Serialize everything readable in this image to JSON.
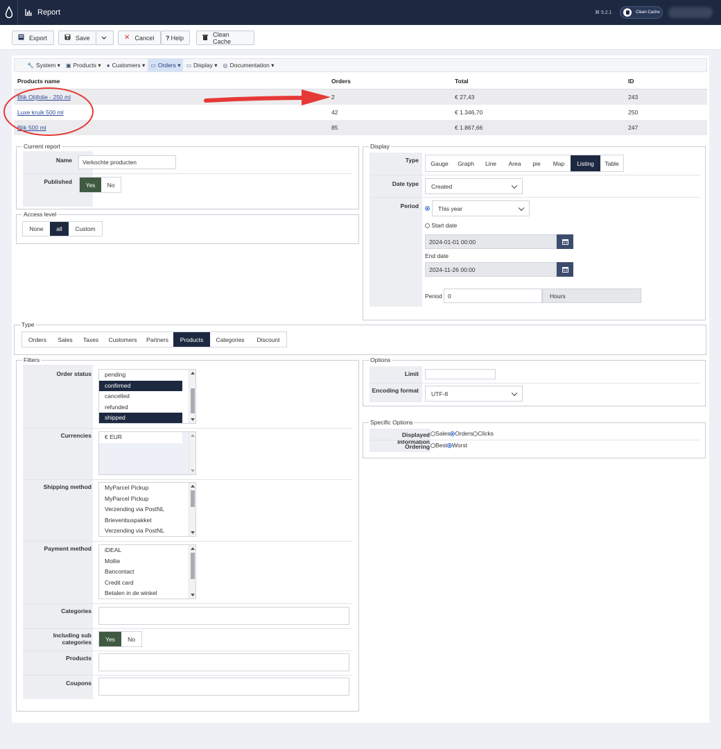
{
  "header": {
    "title": "Report",
    "version": "⌘ 5.2.1",
    "clean_cache": "Clean Cache"
  },
  "toolbar": {
    "export": "Export",
    "save": "Save",
    "cancel": "Cancel",
    "help": "Help",
    "clean_cache": "Clean Cache"
  },
  "menu": {
    "items": [
      {
        "label": "System",
        "icon": "wrench-icon"
      },
      {
        "label": "Products",
        "icon": "cubes-icon"
      },
      {
        "label": "Customers",
        "icon": "user-icon"
      },
      {
        "label": "Orders",
        "icon": "card-icon"
      },
      {
        "label": "Display",
        "icon": "monitor-icon"
      },
      {
        "label": "Documentation",
        "icon": "lifebuoy-icon"
      }
    ],
    "active": "Orders"
  },
  "results": {
    "columns": [
      "Products name",
      "Orders",
      "Total",
      "ID"
    ],
    "rows": [
      {
        "name": "Blik Olijfolie - 250 ml",
        "orders": "2",
        "total": "€ 27,43",
        "id": "243"
      },
      {
        "name": "Luxe kruik 500 ml",
        "orders": "42",
        "total": "€ 1.346,70",
        "id": "250"
      },
      {
        "name": "Blik 500 ml",
        "orders": "85",
        "total": "€ 1.867,66",
        "id": "247"
      }
    ]
  },
  "current_report": {
    "legend": "Current report",
    "name_label": "Name",
    "name_value": "Verkochte producten",
    "published_label": "Published",
    "published_options": [
      "Yes",
      "No"
    ],
    "published_selected": "Yes"
  },
  "access_level": {
    "legend": "Access level",
    "options": [
      "None",
      "all",
      "Custom"
    ],
    "selected": "all"
  },
  "display": {
    "legend": "Display",
    "type_label": "Type",
    "type_options": [
      "Gauge",
      "Graph",
      "Line",
      "Area",
      "pie",
      "Map",
      "Listing",
      "Table"
    ],
    "type_selected": "Listing",
    "date_type_label": "Date type",
    "date_type_value": "Created",
    "period_label": "Period",
    "period_value": "This year",
    "start_date_label": "Start date",
    "start_date_value": "2024-01-01 00:00",
    "end_date_label": "End date",
    "end_date_value": "2024-11-26 00:00",
    "period2_label": "Period",
    "period2_value": "0",
    "period2_unit": "Hours"
  },
  "type_section": {
    "legend": "Type",
    "options": [
      "Orders",
      "Sales",
      "Taxes",
      "Customers",
      "Partners",
      "Products",
      "Categories",
      "Discount"
    ],
    "selected": "Products"
  },
  "filters": {
    "legend": "Filters",
    "order_status_label": "Order status",
    "order_status": [
      {
        "label": "pending",
        "selected": false
      },
      {
        "label": "confirmed",
        "selected": true
      },
      {
        "label": "cancelled",
        "selected": false
      },
      {
        "label": "refunded",
        "selected": false
      },
      {
        "label": "shipped",
        "selected": true
      }
    ],
    "currencies_label": "Currencies",
    "currencies": [
      "€ EUR"
    ],
    "shipping_label": "Shipping method",
    "shipping": [
      "MyParcel Pickup",
      "MyParcel Pickup",
      "Verzending via PostNL",
      "Brievenbuspakket",
      "Verzending via PostNL"
    ],
    "payment_label": "Payment method",
    "payment": [
      "iDEAL",
      "Mollie",
      "Bancontact",
      "Credit card",
      "Betalen in de winkel"
    ],
    "categories_label": "Categories",
    "subcat_label": "Including sub categories",
    "subcat_options": [
      "Yes",
      "No"
    ],
    "subcat_selected": "Yes",
    "products_label": "Products",
    "coupons_label": "Coupons"
  },
  "options": {
    "legend": "Options",
    "limit_label": "Limit",
    "limit_value": "",
    "encoding_label": "Encoding format",
    "encoding_value": "UTF-8"
  },
  "specific": {
    "legend": "Specific Options",
    "displayed_label": "Displayed Information",
    "displayed_options": [
      "Sales",
      "Orders",
      "Clicks"
    ],
    "displayed_selected": "Orders",
    "ordering_label": "Ordering",
    "ordering_options": [
      "Best",
      "Worst"
    ],
    "ordering_selected": "Worst"
  },
  "colors": {
    "navy": "#1d2940",
    "accent_green": "#3f5a41",
    "annotation_red": "#e53935",
    "link_blue": "#2e4a9a"
  }
}
